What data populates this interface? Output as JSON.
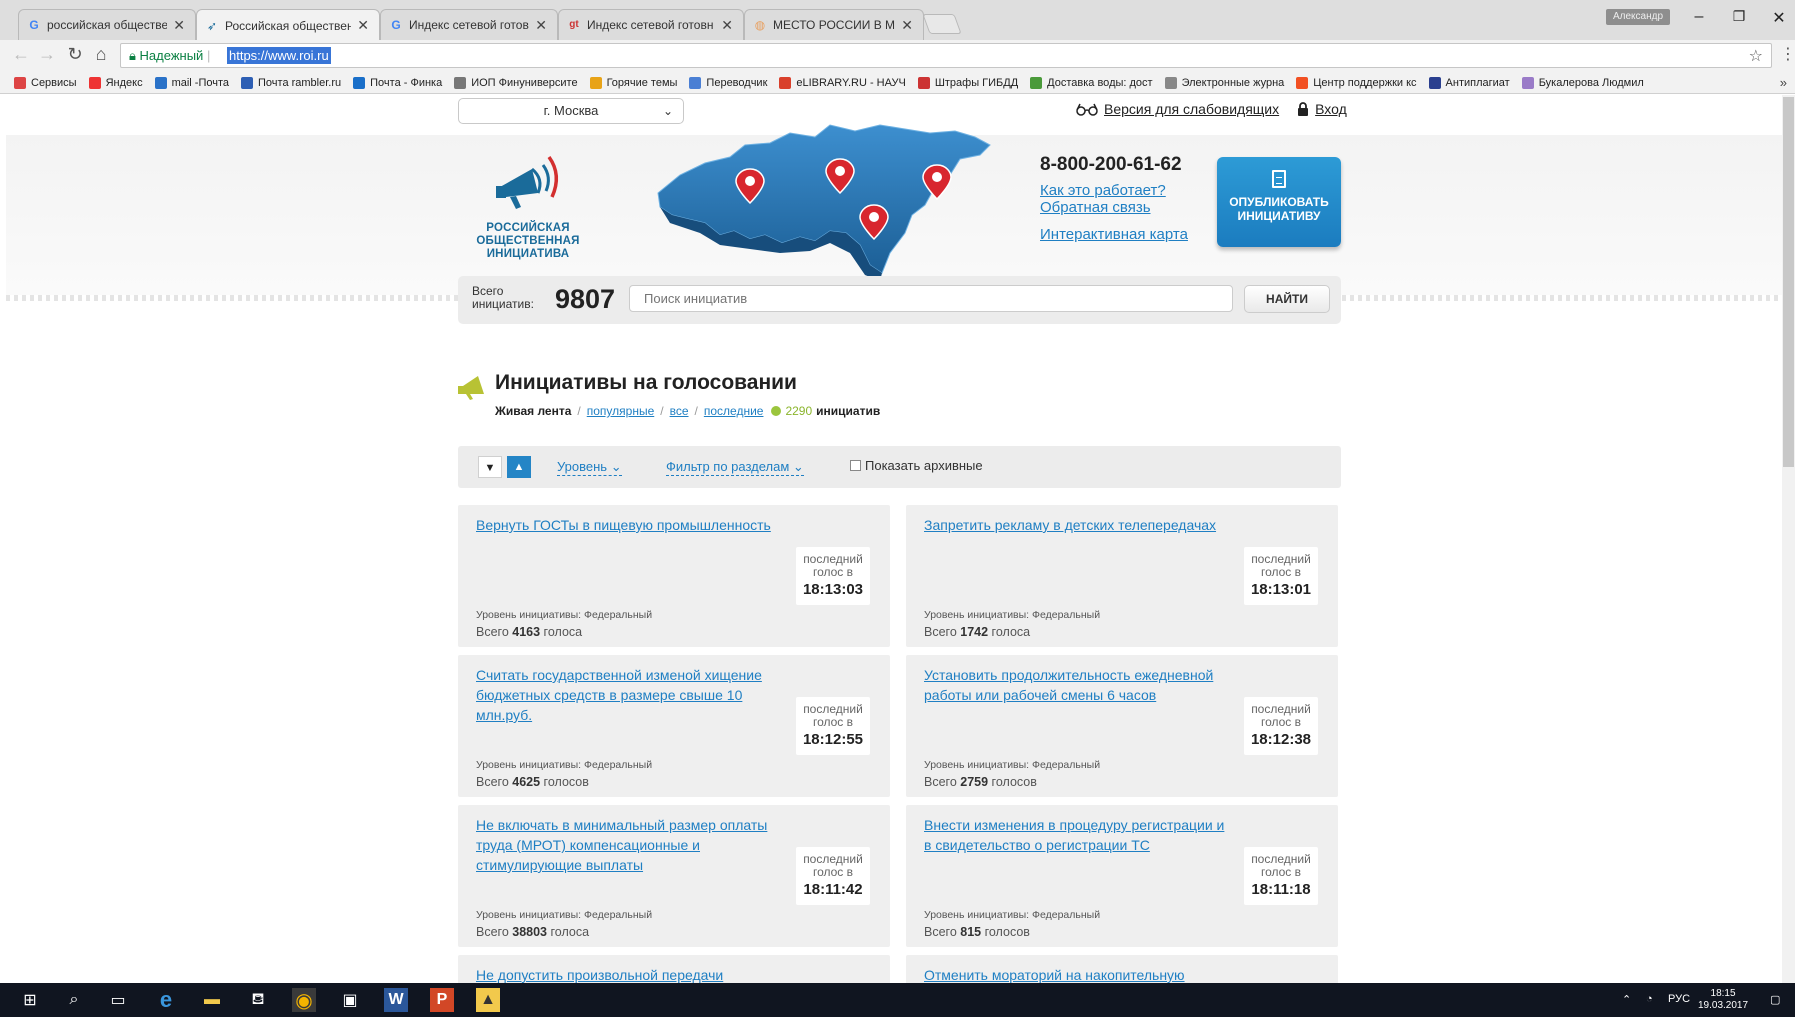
{
  "browser": {
    "tabs": [
      {
        "title": "российская обществен",
        "favicon": "G"
      },
      {
        "title": "Российская обществен",
        "favicon": "roi-icon",
        "active": true
      },
      {
        "title": "Индекс сетевой готовн",
        "favicon": "G"
      },
      {
        "title": "Индекс сетевой готовн",
        "favicon": "gt"
      },
      {
        "title": "МЕСТО РОССИИ В МЕ",
        "favicon": "globe-icon"
      }
    ],
    "user_badge": "Александр",
    "secure_label": "Надежный",
    "url": "https://www.roi.ru",
    "bookmarks": [
      {
        "label": "Сервисы",
        "color": "#d44"
      },
      {
        "label": "Яндекс",
        "color": "#e33"
      },
      {
        "label": "mail -Почта",
        "color": "#2a72c8"
      },
      {
        "label": "Почта rambler.ru",
        "color": "#2e5fb4"
      },
      {
        "label": "Почта - Финка",
        "color": "#1a6fc9"
      },
      {
        "label": "ИОП Финуниверсите",
        "color": "#777"
      },
      {
        "label": "Горячие темы",
        "color": "#e8a317"
      },
      {
        "label": "Переводчик",
        "color": "#4a7fd4"
      },
      {
        "label": "eLIBRARY.RU - НАУЧ",
        "color": "#d9402b"
      },
      {
        "label": "Штрафы ГИБДД",
        "color": "#c33"
      },
      {
        "label": "Доставка воды: дост",
        "color": "#4a9a3a"
      },
      {
        "label": "Электронные журна",
        "color": "#888"
      },
      {
        "label": "Центр поддержки кс",
        "color": "#f25022"
      },
      {
        "label": "Антиплагиат",
        "color": "#2a3f8f"
      },
      {
        "label": "Букалерова Людмил",
        "color": "#9a7bc8"
      }
    ],
    "more": "»"
  },
  "site": {
    "city": "г. Москва",
    "accessibility_link": "Версия для слабовидящих",
    "login_link": "Вход",
    "logo_lines": [
      "РОССИЙСКАЯ",
      "ОБЩЕСТВЕННАЯ",
      "ИНИЦИАТИВА"
    ],
    "phone": "8-800-200-61-62",
    "how_it_works": "Как это работает?",
    "feedback": "Обратная связь",
    "interactive_map": "Интерактивная карта",
    "publish_button": [
      "ОПУБЛИКОВАТЬ",
      "ИНИЦИАТИВУ"
    ],
    "total_label": [
      "Всего",
      "инициатив:"
    ],
    "total_count": "9807",
    "search_placeholder": "Поиск инициатив",
    "find_button": "НАЙТИ"
  },
  "section": {
    "title": "Инициативы на голосовании",
    "live_feed": "Живая лента",
    "popular": "популярные",
    "all": "все",
    "latest": "последние",
    "count": "2290",
    "count_suffix": "инициатив",
    "level_filter": "Уровень",
    "section_filter": "Фильтр по разделам",
    "show_archive": "Показать архивные"
  },
  "cards_labels": {
    "last_vote": [
      "последний",
      "голос в"
    ],
    "level_prefix": "Уровень инициативы: ",
    "total_prefix": "Всего "
  },
  "cards": [
    {
      "title": "Вернуть ГОСТы в пищевую промышленность",
      "time": "18:13:03",
      "level": "Федеральный",
      "votes": "4163",
      "votes_word": "голоса"
    },
    {
      "title": "Запретить рекламу в детских телепередачах",
      "time": "18:13:01",
      "level": "Федеральный",
      "votes": "1742",
      "votes_word": "голоса"
    },
    {
      "title": "Считать государственной изменой хищение бюджетных средств в размере свыше 10 млн.руб.",
      "time": "18:12:55",
      "level": "Федеральный",
      "votes": "4625",
      "votes_word": "голосов"
    },
    {
      "title": "Установить продолжительность ежедневной работы или рабочей смены 6 часов",
      "time": "18:12:38",
      "level": "Федеральный",
      "votes": "2759",
      "votes_word": "голосов"
    },
    {
      "title": "Не включать в минимальный размер оплаты труда (МРОТ) компенсационные и стимулирующие выплаты",
      "time": "18:11:42",
      "level": "Федеральный",
      "votes": "38803",
      "votes_word": "голоса"
    },
    {
      "title": "Внести изменения в процедуру регистрации и в свидетельство о регистрации ТС",
      "time": "18:11:18",
      "level": "Федеральный",
      "votes": "815",
      "votes_word": "голосов"
    },
    {
      "title": "Не допустить произвольной передачи"
    },
    {
      "title": "Отменить мораторий на накопительную"
    }
  ],
  "taskbar": {
    "lang": "РУС",
    "time": "18:15",
    "date": "19.03.2017"
  }
}
